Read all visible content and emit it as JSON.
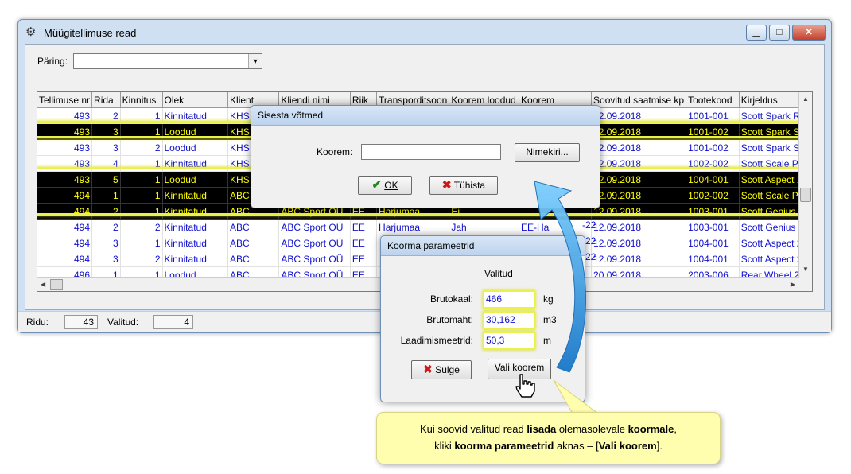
{
  "window": {
    "title": "Müügitellimuse read",
    "icon": "gear-icon",
    "controls": {
      "minimize": "▁",
      "maximize": "□",
      "close": "✕"
    }
  },
  "query": {
    "label": "Päring:",
    "value": ""
  },
  "grid": {
    "columns": [
      "Tellimuse nr",
      "Rida",
      "Kinnitus",
      "Olek",
      "Klient",
      "Kliendi nimi",
      "Riik",
      "Transporditsoon",
      "Koorem loodud",
      "Koorem",
      "Soovitud saatmise kp",
      "Tootekood",
      "Kirjeldus"
    ],
    "rows": [
      {
        "selected": false,
        "cells": [
          "493",
          "2",
          "1",
          "Kinnitatud",
          "KHS",
          "",
          "",
          "",
          "",
          "",
          "12.09.2018",
          "1001-001",
          "Scott Spark RC"
        ]
      },
      {
        "selected": true,
        "cells": [
          "493",
          "3",
          "1",
          "Loodud",
          "KHS",
          "",
          "",
          "",
          "",
          "",
          "12.09.2018",
          "1001-002",
          "Scott Spark SL"
        ]
      },
      {
        "selected": false,
        "cells": [
          "493",
          "3",
          "2",
          "Loodud",
          "KHS",
          "",
          "",
          "",
          "",
          "",
          "12.09.2018",
          "1001-002",
          "Scott Spark SL"
        ]
      },
      {
        "selected": false,
        "cells": [
          "493",
          "4",
          "1",
          "Kinnitatud",
          "KHS",
          "",
          "",
          "",
          "",
          "",
          "12.09.2018",
          "1002-002",
          "Scott Scale Pre"
        ]
      },
      {
        "selected": true,
        "cells": [
          "493",
          "5",
          "1",
          "Loodud",
          "KHS",
          "",
          "",
          "",
          "",
          "",
          "12.09.2018",
          "1004-001",
          "Scott Aspect 1"
        ]
      },
      {
        "selected": true,
        "cells": [
          "494",
          "1",
          "1",
          "Kinnitatud",
          "ABC",
          "",
          "",
          "",
          "",
          "",
          "12.09.2018",
          "1002-002",
          "Scott Scale Pre"
        ]
      },
      {
        "selected": true,
        "cells": [
          "494",
          "2",
          "1",
          "Kinnitatud",
          "ABC",
          "ABC Sport OÜ",
          "EE",
          "Harjumaa",
          "Ei",
          "",
          "12.09.2018",
          "1003-001",
          "Scott Genius 2"
        ]
      },
      {
        "selected": false,
        "cells": [
          "494",
          "2",
          "2",
          "Kinnitatud",
          "ABC",
          "ABC Sport OÜ",
          "EE",
          "Harjumaa",
          "Jah",
          "EE-Ha",
          "12.09.2018",
          "1003-001",
          "Scott Genius 2"
        ]
      },
      {
        "selected": false,
        "cells": [
          "494",
          "3",
          "1",
          "Kinnitatud",
          "ABC",
          "ABC Sport OÜ",
          "EE",
          "",
          "",
          "",
          "12.09.2018",
          "1004-001",
          "Scott Aspect 2"
        ]
      },
      {
        "selected": false,
        "cells": [
          "494",
          "3",
          "2",
          "Kinnitatud",
          "ABC",
          "ABC Sport OÜ",
          "EE",
          "",
          "",
          "",
          "12.09.2018",
          "1004-001",
          "Scott Aspect 2"
        ]
      },
      {
        "selected": false,
        "cells": [
          "496",
          "1",
          "1",
          "Loodud",
          "ABC",
          "ABC Sport OÜ",
          "EE",
          "",
          "",
          "",
          "20.09.2018",
          "2003-006",
          "Rear Wheel 29"
        ]
      }
    ],
    "koorem_suffixes": [
      "-22",
      "-22",
      "-22"
    ]
  },
  "status": {
    "rows_label": "Ridu:",
    "rows_value": "43",
    "selected_label": "Valitud:",
    "selected_value": "4"
  },
  "keys_dialog": {
    "title": "Sisesta võtmed",
    "field_label": "Koorem:",
    "field_value": "",
    "list_button": "Nimekiri...",
    "ok_button": "OK",
    "cancel_button": "Tühista"
  },
  "params_dialog": {
    "title": "Koorma parameetrid",
    "column_header": "Valitud",
    "params": [
      {
        "label": "Brutokaal:",
        "value": "466",
        "unit": "kg"
      },
      {
        "label": "Brutomaht:",
        "value": "30,162",
        "unit": "m3"
      },
      {
        "label": "Laadimismeetrid:",
        "value": "50,3",
        "unit": "m"
      }
    ],
    "close_button": "Sulge",
    "choose_button": "Vali koorem"
  },
  "callout": {
    "line1_a": "Kui soovid valitud read ",
    "line1_b": "lisada",
    "line1_c": " olemasolevale ",
    "line1_d": "koormale",
    "line1_e": ",",
    "line2_a": "kliki ",
    "line2_b": "koorma parameetrid",
    "line2_c": " aknas – [",
    "line2_d": "Vali koorem",
    "line2_e": "]."
  },
  "colors": {
    "link_blue": "#1010d0",
    "selection_yellow": "#ffff00",
    "highlight": "#ecf04e",
    "callout_bg": "#fffdae",
    "arrow_blue": "#2a8fd8"
  }
}
